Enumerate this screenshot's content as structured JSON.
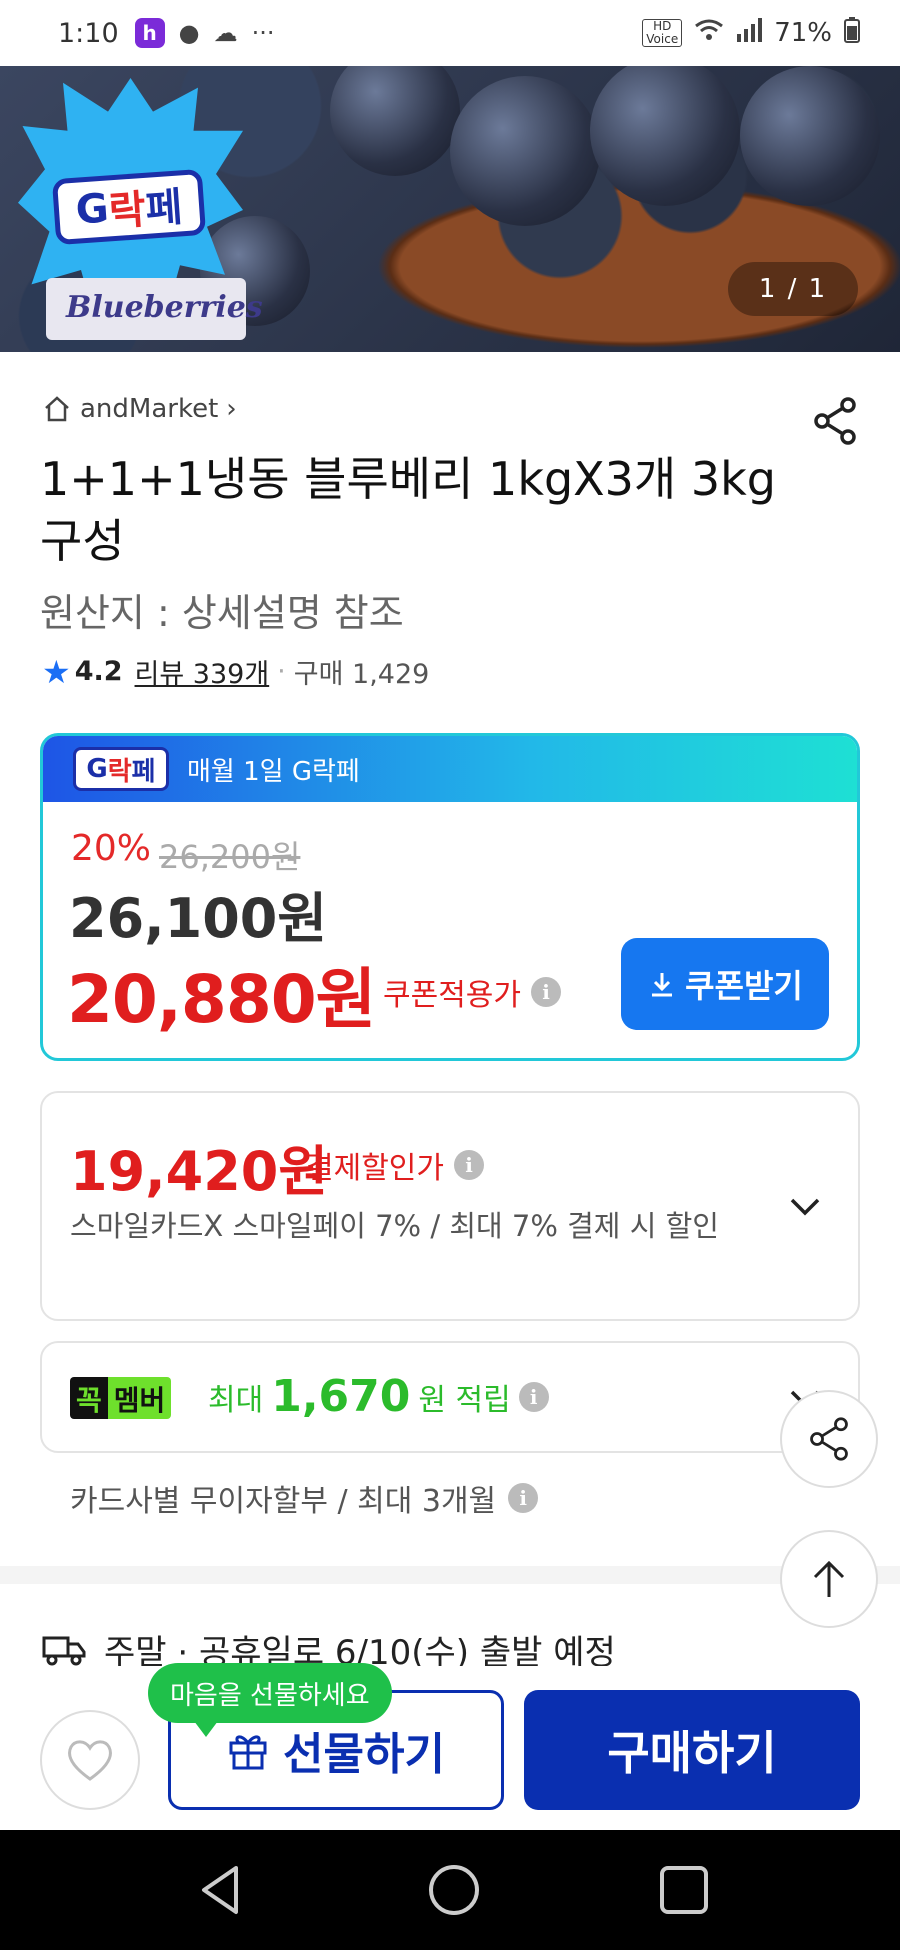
{
  "status_bar": {
    "time": "1:10",
    "app_icon_letter": "h",
    "more": "···",
    "hd_label": "HD\nVoice",
    "battery": "71%"
  },
  "hero": {
    "badge_brand": "G락페",
    "badge_product": "Blueberries",
    "counter": "1 / 1"
  },
  "product": {
    "store_name": "andMarket",
    "title": "1+1+1냉동 블루베리 1kgX3개 3kg 구성",
    "origin": "원산지 : 상세설명 참조",
    "rating": "4.2",
    "reviews": "리뷰 339개",
    "purchases": "구매 1,429"
  },
  "price_box": {
    "header_text": "매월 1일 G락페",
    "discount_rate": "20%",
    "original_price": "26,200원",
    "sale_price": "26,100원",
    "coupon_price": "20,880원",
    "coupon_label": "쿠폰적용가",
    "coupon_button": "쿠폰받기"
  },
  "payment": {
    "price": "19,420원",
    "label": "결제할인가",
    "description": "스마일카드X 스마일페이 7%  / 최대 7% 결제 시 할인"
  },
  "member": {
    "badge_a": "꼭",
    "badge_b": "멤버",
    "prefix": "최대",
    "amount": "1,670",
    "suffix": "원 적립"
  },
  "installment": "카드사별 무이자할부 / 최대 3개월",
  "shipping": "주말 · 공휴일로 6/10(수) 출발 예정",
  "bottom": {
    "tooltip": "마음을 선물하세요",
    "gift_button": "선물하기",
    "buy_button": "구매하기"
  },
  "colors": {
    "accent_blue": "#0a2fb0",
    "price_red": "#e01e1e",
    "member_green": "#2bbb2b",
    "coupon_blue": "#1677f0"
  }
}
